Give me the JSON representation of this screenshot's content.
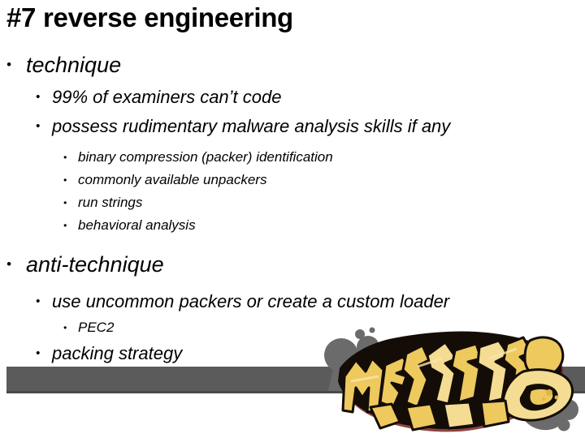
{
  "slide": {
    "title": "#7 reverse engineering",
    "background_color": "#ffffff",
    "text_color": "#000000",
    "footer_bar_color": "#5b5b5b",
    "outline": [
      {
        "level": 1,
        "bullet": "•",
        "text": "technique"
      },
      {
        "level": 2,
        "bullet": "•",
        "text": "99% of examiners can’t code"
      },
      {
        "level": 2,
        "bullet": "•",
        "text": "possess rudimentary malware analysis skills if any"
      },
      {
        "level": 3,
        "bullet": "•",
        "text": "binary compression (packer) identification"
      },
      {
        "level": 3,
        "bullet": "•",
        "text": "commonly available unpackers"
      },
      {
        "level": 3,
        "bullet": "•",
        "text": "run strings"
      },
      {
        "level": 3,
        "bullet": "•",
        "text": "behavioral analysis"
      },
      {
        "level": 1,
        "bullet": "•",
        "text": "anti-technique"
      },
      {
        "level": 2,
        "bullet": "•",
        "text": "use uncommon packers or create a custom loader"
      },
      {
        "level": 3,
        "bullet": "•",
        "text": "PEC2"
      },
      {
        "level": 2,
        "bullet": "•",
        "text": "packing strategy"
      }
    ]
  },
  "logo": {
    "name": "metasploit-graffiti-logo",
    "style": "graffiti wildstyle lettering",
    "fill_color": "#edc95e",
    "highlight_color": "#f4dc93",
    "outline_color": "#120d06",
    "shadow_color": "#6b1d1d",
    "bubble_color": "#6b6b6b"
  }
}
